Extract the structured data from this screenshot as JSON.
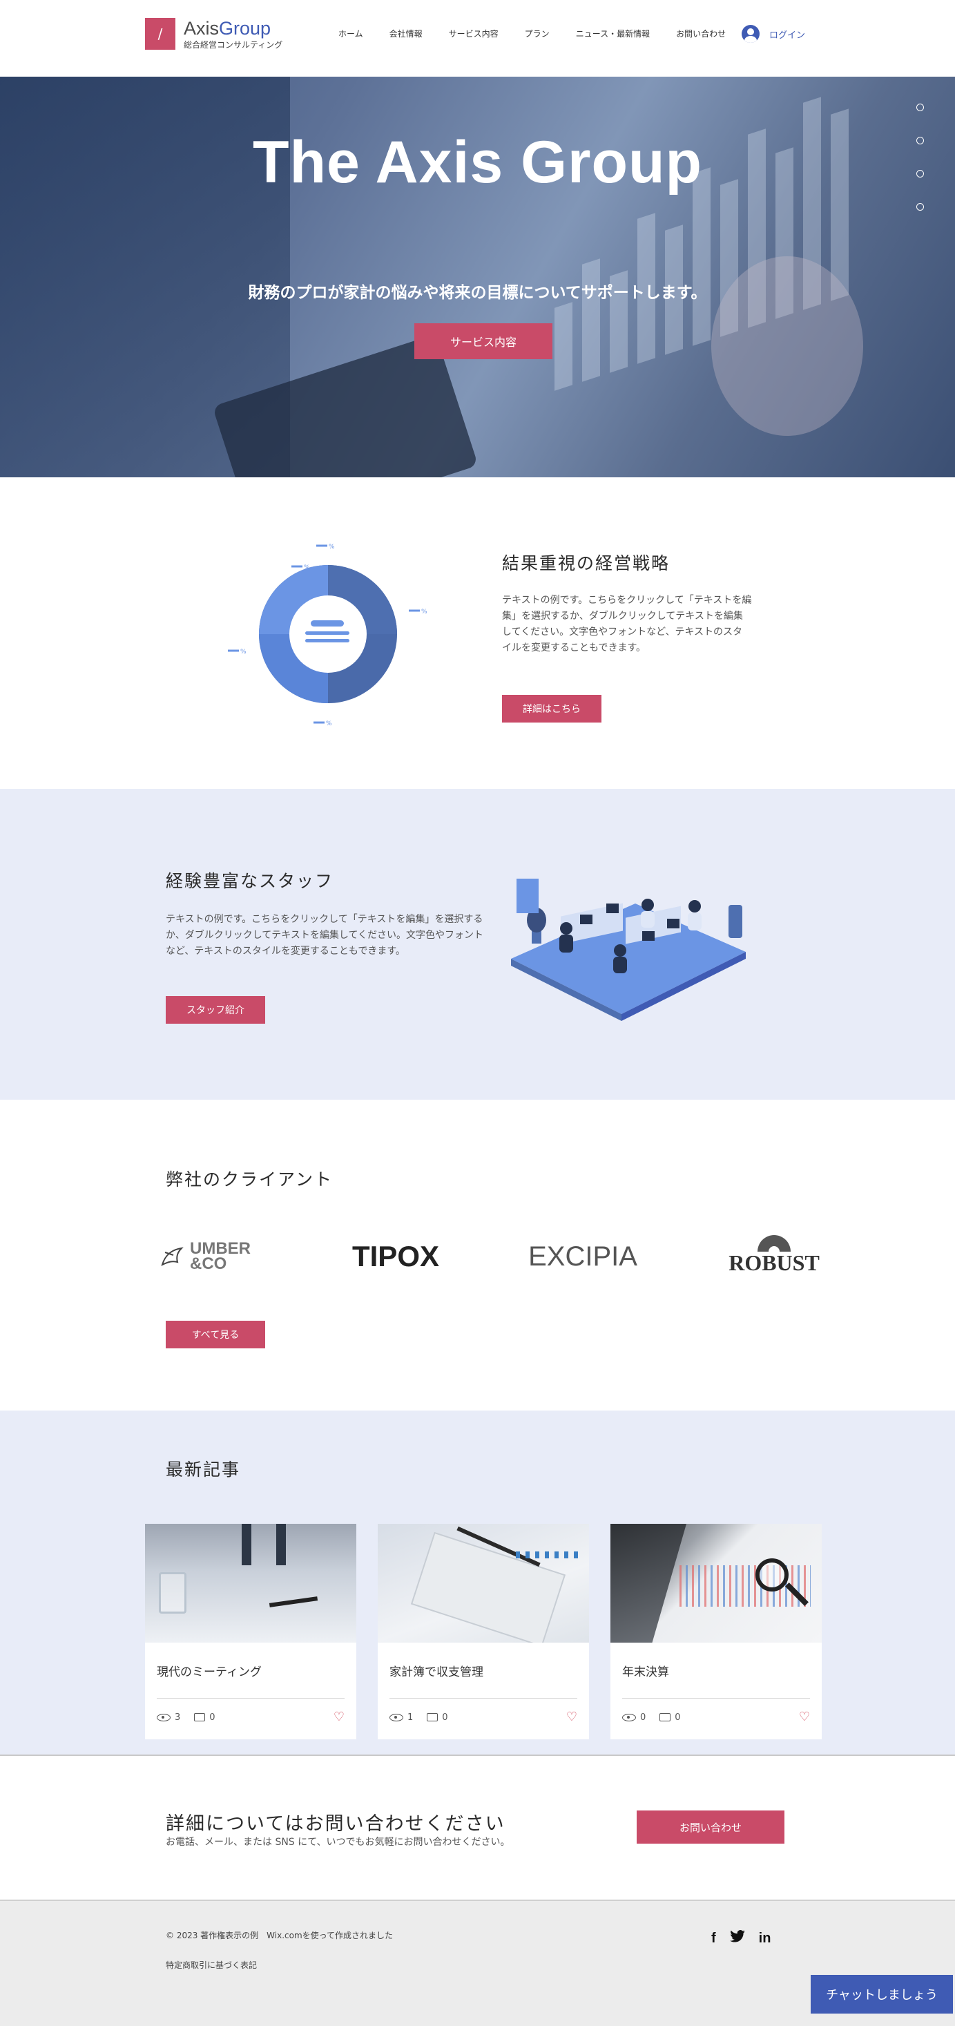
{
  "header": {
    "logo_mark": "/",
    "logo_name_a": "Axis",
    "logo_name_b": "Group",
    "logo_sub": "総合経営コンサルティング",
    "nav": [
      "ホーム",
      "会社情報",
      "サービス内容",
      "プラン",
      "ニュース・最新情報",
      "お問い合わせ"
    ],
    "login": "ログイン"
  },
  "hero": {
    "title": "The Axis Group",
    "subtitle": "財務のプロが家計の悩みや将来の目標についてサポートします。",
    "button": "サービス内容"
  },
  "strategy": {
    "title": "結果重視の経営戦略",
    "text": "テキストの例です。こちらをクリックして「テキストを編集」を選択するか、ダブルクリックしてテキストを編集してください。文字色やフォントなど、テキストのスタイルを変更することもできます。",
    "button": "詳細はこちら",
    "donut_label": "%"
  },
  "staff": {
    "title": "経験豊富なスタッフ",
    "text": "テキストの例です。こちらをクリックして「テキストを編集」を選択するか、ダブルクリックしてテキストを編集してください。文字色やフォントなど、テキストのスタイルを変更することもできます。",
    "button": "スタッフ紹介"
  },
  "clients": {
    "title": "弊社のクライアント",
    "logos": [
      "UMBER &CO",
      "TIPOX",
      "EXCIPIA",
      "ROBUST"
    ],
    "button": "すべて見る"
  },
  "posts": {
    "title": "最新記事",
    "items": [
      {
        "title": "現代のミーティング",
        "views": "3",
        "comments": "0"
      },
      {
        "title": "家計簿で収支管理",
        "views": "1",
        "comments": "0"
      },
      {
        "title": "年末決算",
        "views": "0",
        "comments": "0"
      }
    ]
  },
  "contact": {
    "title": "詳細についてはお問い合わせください",
    "subtitle": "お電話、メール、または SNS にて、いつでもお気軽にお問い合わせください。",
    "button": "お問い合わせ"
  },
  "footer": {
    "copyright": "© 2023 著作権表示の例　Wix.comを使って作成されました",
    "legal": "特定商取引に基づく表記",
    "socials": [
      "f",
      "t",
      "in"
    ]
  },
  "chat": {
    "label": "チャットしましょう"
  },
  "colors": {
    "accent": "#c94b68",
    "brand": "#3f5bb4",
    "section_bg": "#e8ecf8"
  }
}
